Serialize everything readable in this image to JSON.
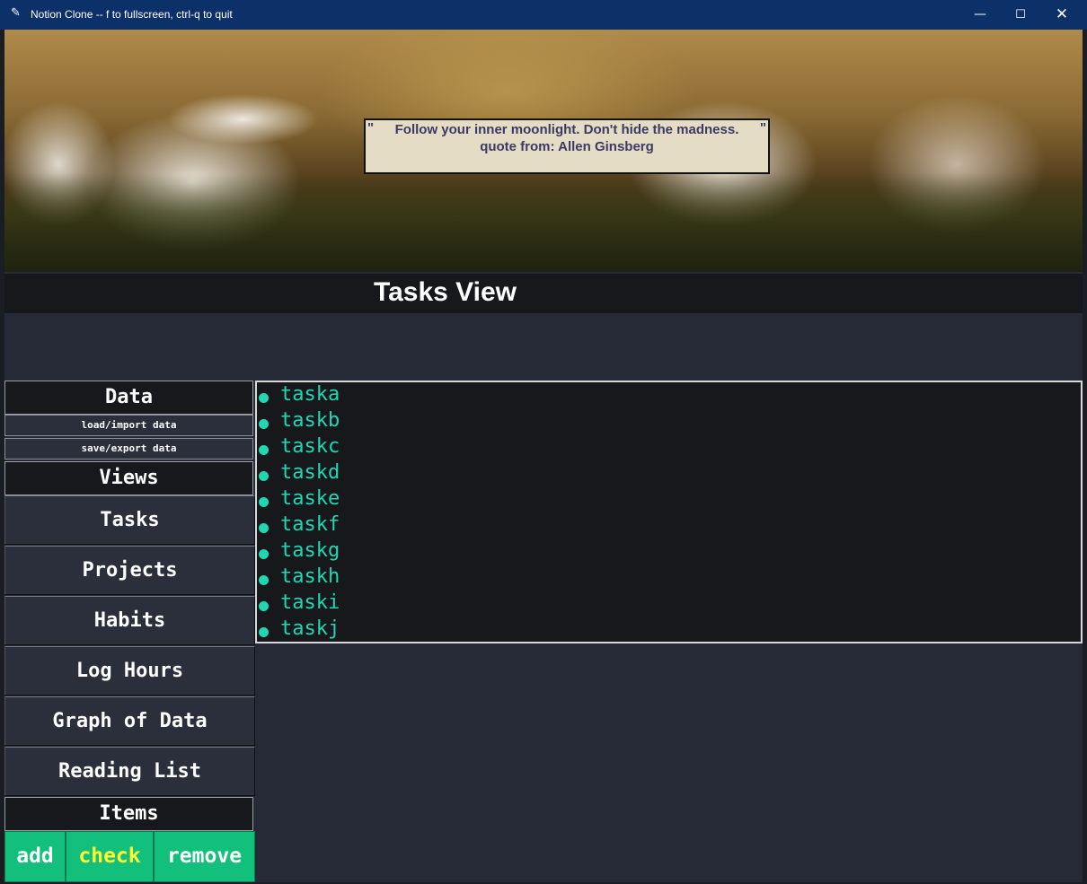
{
  "window": {
    "title": "Notion Clone -- f to fullscreen, ctrl-q to quit",
    "controls": {
      "minimize": "—",
      "maximize": "☐",
      "close": "✕"
    }
  },
  "banner": {
    "quote_text": "Follow your inner moonlight. Don't hide the madness.",
    "quote_open": "\"",
    "quote_close": "\"",
    "attribution": "quote from: Allen Ginsberg"
  },
  "header": {
    "title": "Tasks View"
  },
  "sidebar": {
    "data_heading": "Data",
    "load_label": "load/import data",
    "save_label": "save/export data",
    "views_heading": "Views",
    "views": [
      {
        "label": "Tasks"
      },
      {
        "label": "Projects"
      },
      {
        "label": "Habits"
      },
      {
        "label": "Log Hours"
      },
      {
        "label": "Graph of Data"
      },
      {
        "label": "Reading List"
      }
    ],
    "items_heading": "Items",
    "actions": {
      "add": "add",
      "check": "check",
      "remove": "remove"
    }
  },
  "tasks": [
    "taska",
    "taskb",
    "taskc",
    "taskd",
    "taske",
    "taskf",
    "taskg",
    "taskh",
    "taski",
    "taskj"
  ],
  "colors": {
    "titlebar": "#0c3068",
    "background": "#262936",
    "panel": "#17181c",
    "task_text": "#20d7b2",
    "action_button": "#12c07b",
    "check_text": "#ffff33",
    "quote_text": "#3a3a63",
    "quote_bg": "#e5dcc5"
  }
}
